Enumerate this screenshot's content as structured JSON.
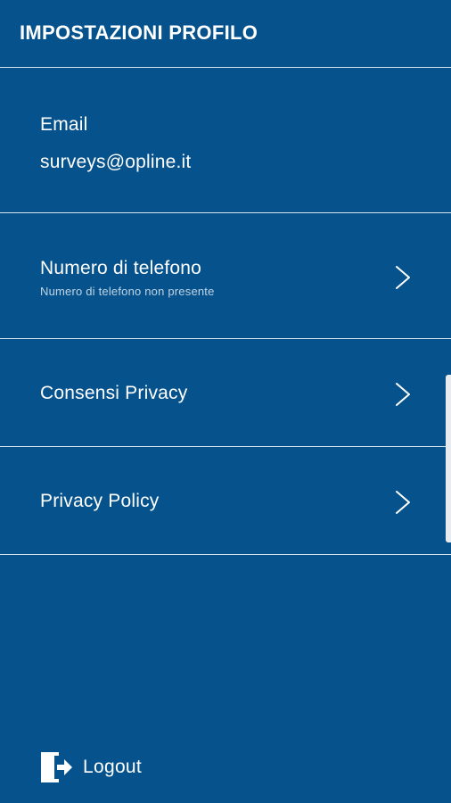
{
  "header": {
    "title": "IMPOSTAZIONI PROFILO"
  },
  "email": {
    "label": "Email",
    "value": "surveys@opline.it"
  },
  "phone": {
    "label": "Numero di telefono",
    "sublabel": "Numero di telefono non presente"
  },
  "consents": {
    "label": "Consensi Privacy"
  },
  "policy": {
    "label": "Privacy Policy"
  },
  "logout": {
    "label": "Logout",
    "icon": "logout-icon"
  },
  "colors": {
    "background": "#05528c",
    "text": "#ffffff",
    "divider": "#ffffff"
  }
}
